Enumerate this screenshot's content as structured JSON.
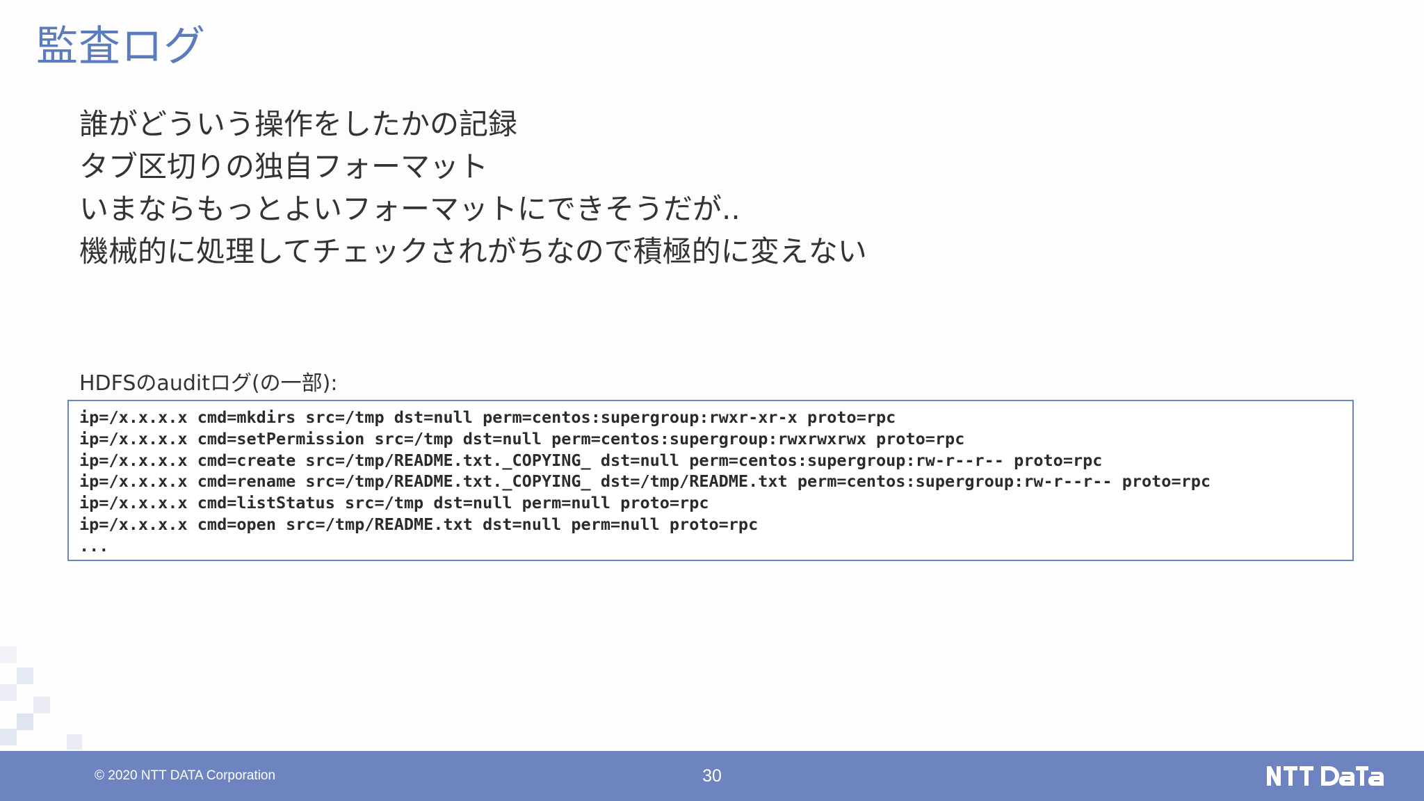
{
  "slide": {
    "title": "監査ログ",
    "bullets": [
      "誰がどういう操作をしたかの記録",
      "タブ区切りの独自フォーマット",
      "いまならもっとよいフォーマットにできそうだが..",
      "機械的に処理してチェックされがちなので積極的に変えない"
    ],
    "log_caption": "HDFSのauditログ(の一部):",
    "log_lines": [
      "ip=/x.x.x.x cmd=mkdirs src=/tmp dst=null perm=centos:supergroup:rwxr-xr-x proto=rpc",
      "ip=/x.x.x.x cmd=setPermission src=/tmp dst=null perm=centos:supergroup:rwxrwxrwx proto=rpc",
      "ip=/x.x.x.x cmd=create src=/tmp/README.txt._COPYING_ dst=null perm=centos:supergroup:rw-r--r-- proto=rpc",
      "ip=/x.x.x.x cmd=rename src=/tmp/README.txt._COPYING_ dst=/tmp/README.txt perm=centos:supergroup:rw-r--r-- proto=rpc",
      "ip=/x.x.x.x cmd=listStatus src=/tmp dst=null perm=null proto=rpc",
      "ip=/x.x.x.x cmd=open src=/tmp/README.txt dst=null perm=null proto=rpc",
      "..."
    ]
  },
  "footer": {
    "copyright": "© 2020 NTT DATA Corporation",
    "page_number": "30",
    "logo_text": "NTT DATA"
  },
  "colors": {
    "accent": "#5b7bbf",
    "footer_bg": "#6d84c1",
    "text": "#333333",
    "log_border": "#6a84c2"
  }
}
